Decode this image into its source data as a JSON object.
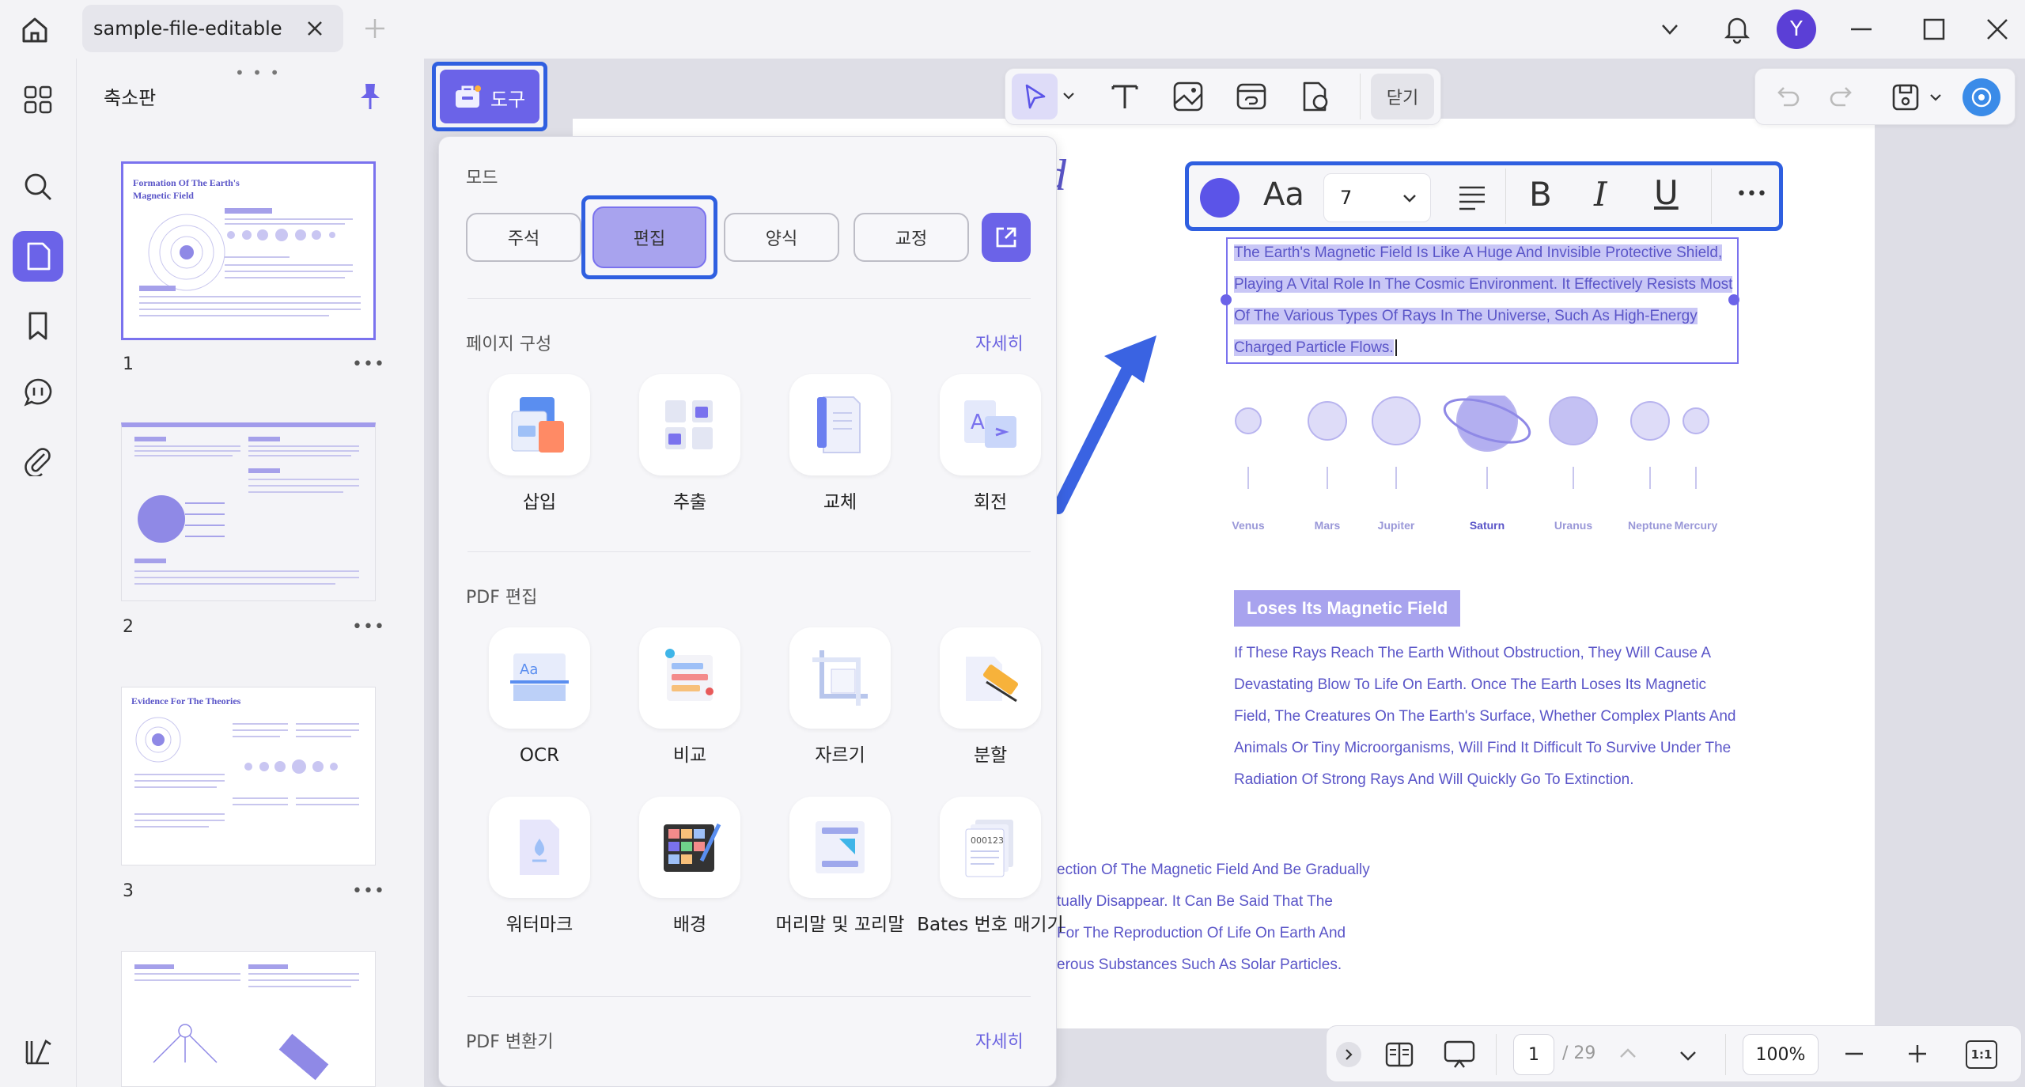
{
  "tab": {
    "title": "sample-file-editable"
  },
  "account": {
    "initial": "Y"
  },
  "thumbnails": {
    "title": "축소판",
    "pages": [
      {
        "number": "1",
        "heading": "Formation Of The Earth's Magnetic Field"
      },
      {
        "number": "2",
        "heading": ""
      },
      {
        "number": "3",
        "heading": "Evidence For The Theories"
      },
      {
        "number": "",
        "heading": ""
      }
    ]
  },
  "tools": {
    "button_label": "도구",
    "mode_title": "모드",
    "modes": [
      "주석",
      "편집",
      "양식",
      "교정"
    ],
    "page_section": {
      "title": "페이지 구성",
      "more": "자세히",
      "items": [
        "삽입",
        "추출",
        "교체",
        "회전"
      ]
    },
    "pdf_edit_section": {
      "title": "PDF 편집",
      "items": [
        "OCR",
        "비교",
        "자르기",
        "분할",
        "워터마크",
        "배경",
        "머리말 및 꼬리말",
        "Bates 번호 매기기"
      ]
    },
    "converter_section": {
      "title": "PDF 변환기",
      "more": "자세히"
    }
  },
  "top_toolbar": {
    "close_label": "닫기"
  },
  "format_bar": {
    "font_label": "Aa",
    "font_size": "7",
    "color": "#5b54e8"
  },
  "document": {
    "selected_text": [
      "The Earth's Magnetic Field Is Like A Huge And Invisible Protective Shield,",
      "Playing A Vital Role In The Cosmic Environment. It Effectively Resists Most",
      "Of The Various Types Of Rays In The Universe, Such As High-Energy",
      "Charged Particle Flows."
    ],
    "title_fragment": "d",
    "planets": [
      "Venus",
      "Mars",
      "Jupiter",
      "Saturn",
      "Uranus",
      "Neptune",
      "Mercury"
    ],
    "section_heading": "Loses Its Magnetic Field",
    "body": [
      "If These Rays Reach The Earth Without Obstruction, They Will Cause A",
      "Devastating Blow To Life On Earth. Once The Earth Loses Its Magnetic",
      "Field, The Creatures On The Earth's Surface, Whether Complex Plants And",
      "Animals Or Tiny Microorganisms, Will Find It Difficult To Survive Under The",
      "Radiation Of Strong Rays And Will Quickly Go To Extinction."
    ],
    "body2": [
      "ection Of The Magnetic Field And Be Gradually",
      "tually Disappear. It Can Be Said That The",
      "For The Reproduction Of Life On Earth And",
      "erous Substances Such As Solar Particles."
    ]
  },
  "pagination": {
    "current": "1",
    "total": "/ 29",
    "zoom": "100%"
  },
  "colors": {
    "accent": "#5b54e8",
    "highlight_border": "#2f5fe0"
  }
}
